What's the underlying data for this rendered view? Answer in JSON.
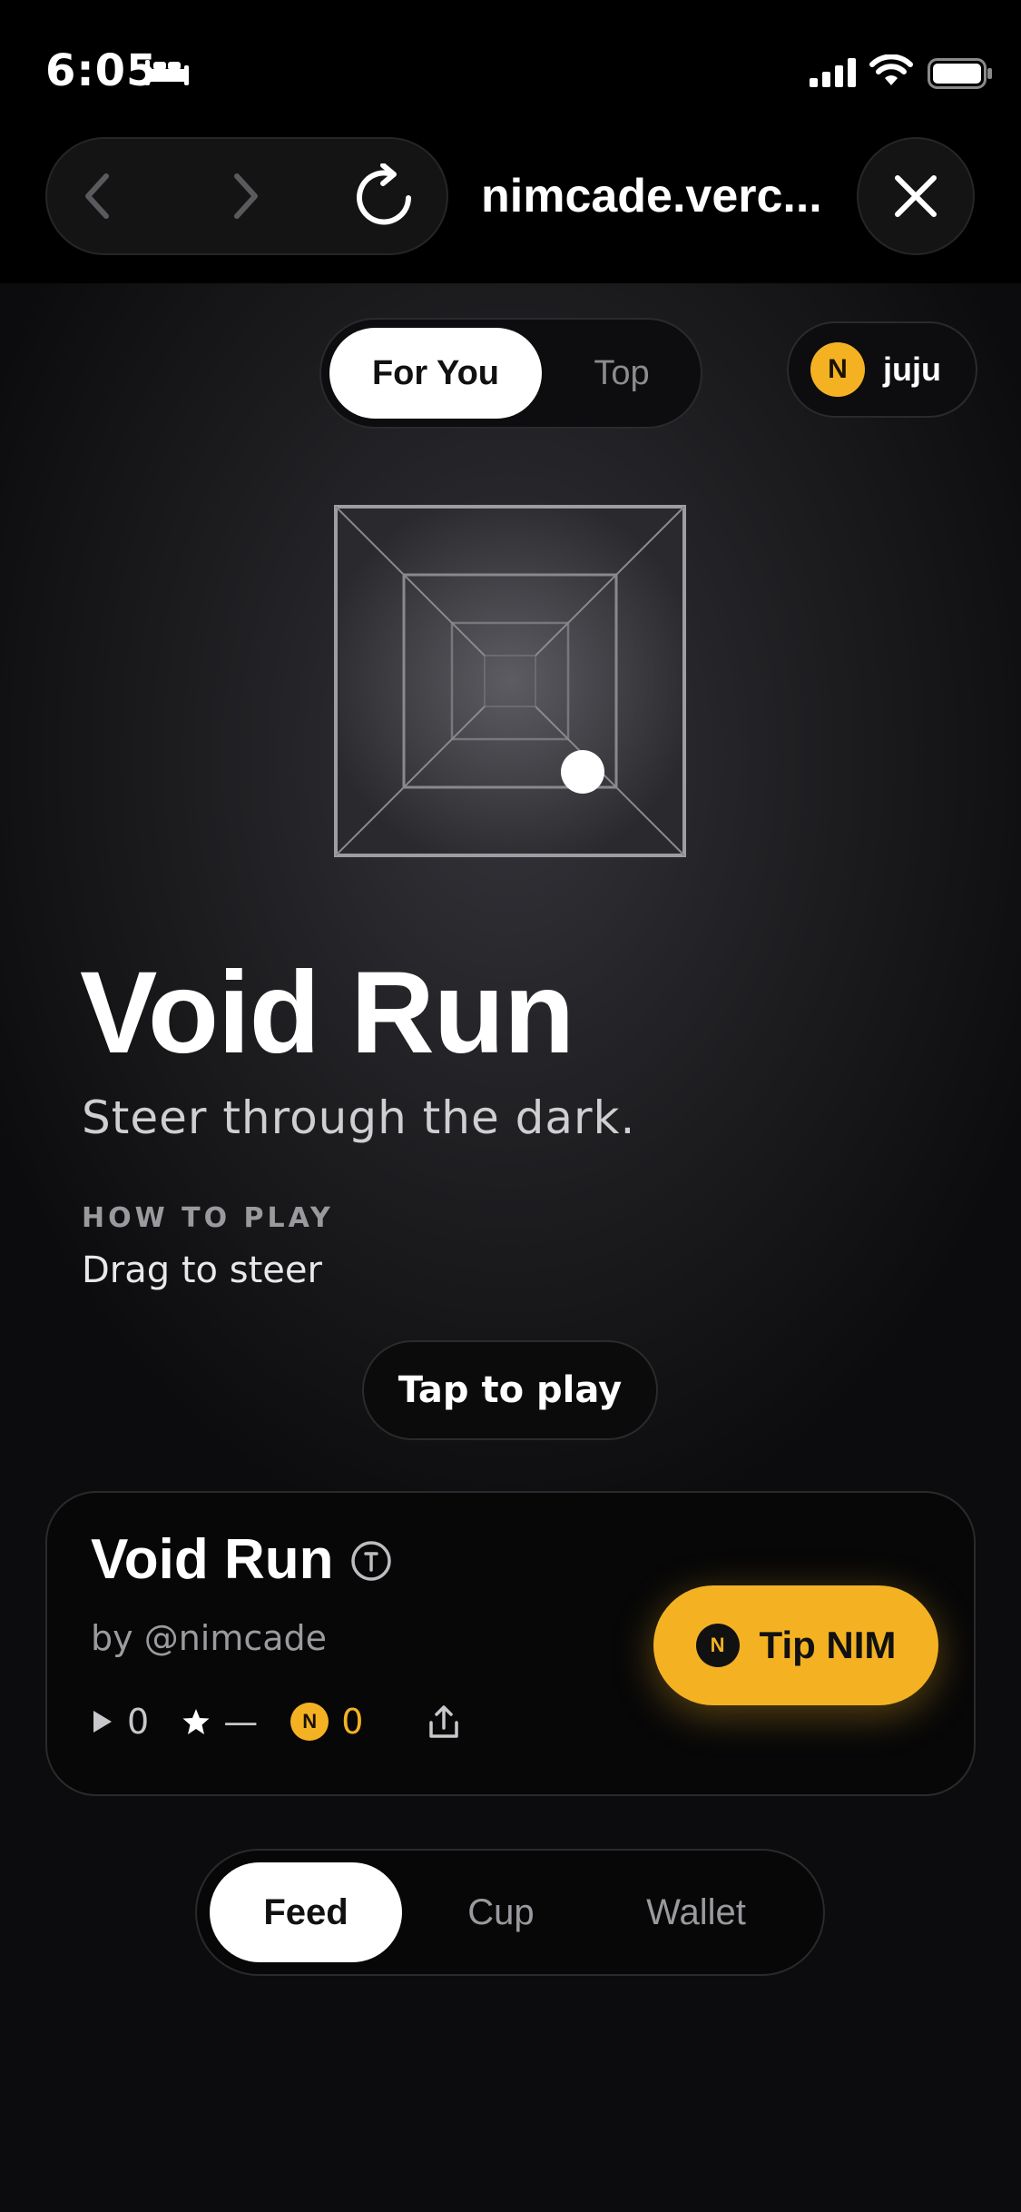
{
  "status_bar": {
    "time": "6:05",
    "icons": [
      "bed-icon",
      "cellular-signal-icon",
      "wifi-icon",
      "battery-icon"
    ]
  },
  "browser": {
    "url": "nimcade.verc...",
    "icons": [
      "back-icon",
      "forward-icon",
      "reload-icon",
      "close-icon"
    ]
  },
  "feed_tabs": [
    {
      "label": "For You",
      "active": true
    },
    {
      "label": "Top",
      "active": false
    }
  ],
  "user": {
    "coin_symbol": "N",
    "name": "juju"
  },
  "game": {
    "title": "Void Run",
    "subtitle": "Steer through the dark.",
    "how_to_label": "HOW TO PLAY",
    "how_to_text": "Drag to steer",
    "play_label": "Tap to play"
  },
  "card": {
    "title": "Void Run",
    "author": "by @nimcade",
    "stats": {
      "plays": "0",
      "rating": "—",
      "coin_symbol": "N",
      "tips": "0"
    },
    "tip_coin_symbol": "N",
    "tip_label": "Tip NIM"
  },
  "bottom_nav": [
    {
      "label": "Feed",
      "active": true
    },
    {
      "label": "Cup",
      "active": false
    },
    {
      "label": "Wallet",
      "active": false
    }
  ],
  "colors": {
    "accent": "#f4b223",
    "background": "#000000"
  }
}
